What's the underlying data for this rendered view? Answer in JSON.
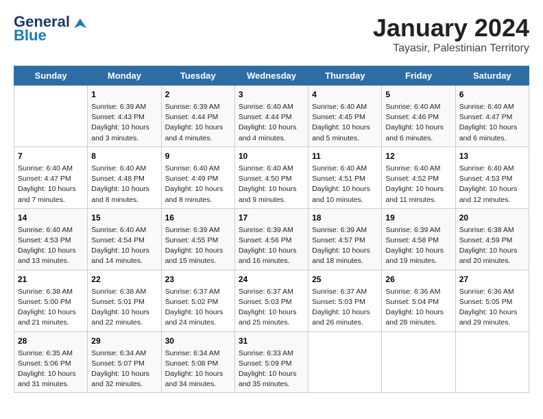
{
  "logo": {
    "line1": "General",
    "line2": "Blue"
  },
  "title": "January 2024",
  "subtitle": "Tayasir, Palestinian Territory",
  "days_of_week": [
    "Sunday",
    "Monday",
    "Tuesday",
    "Wednesday",
    "Thursday",
    "Friday",
    "Saturday"
  ],
  "weeks": [
    [
      {
        "day": "",
        "info": ""
      },
      {
        "day": "1",
        "info": "Sunrise: 6:39 AM\nSunset: 4:43 PM\nDaylight: 10 hours and 3 minutes."
      },
      {
        "day": "2",
        "info": "Sunrise: 6:39 AM\nSunset: 4:44 PM\nDaylight: 10 hours and 4 minutes."
      },
      {
        "day": "3",
        "info": "Sunrise: 6:40 AM\nSunset: 4:44 PM\nDaylight: 10 hours and 4 minutes."
      },
      {
        "day": "4",
        "info": "Sunrise: 6:40 AM\nSunset: 4:45 PM\nDaylight: 10 hours and 5 minutes."
      },
      {
        "day": "5",
        "info": "Sunrise: 6:40 AM\nSunset: 4:46 PM\nDaylight: 10 hours and 6 minutes."
      },
      {
        "day": "6",
        "info": "Sunrise: 6:40 AM\nSunset: 4:47 PM\nDaylight: 10 hours and 6 minutes."
      }
    ],
    [
      {
        "day": "7",
        "info": "Sunrise: 6:40 AM\nSunset: 4:47 PM\nDaylight: 10 hours and 7 minutes."
      },
      {
        "day": "8",
        "info": "Sunrise: 6:40 AM\nSunset: 4:48 PM\nDaylight: 10 hours and 8 minutes."
      },
      {
        "day": "9",
        "info": "Sunrise: 6:40 AM\nSunset: 4:49 PM\nDaylight: 10 hours and 8 minutes."
      },
      {
        "day": "10",
        "info": "Sunrise: 6:40 AM\nSunset: 4:50 PM\nDaylight: 10 hours and 9 minutes."
      },
      {
        "day": "11",
        "info": "Sunrise: 6:40 AM\nSunset: 4:51 PM\nDaylight: 10 hours and 10 minutes."
      },
      {
        "day": "12",
        "info": "Sunrise: 6:40 AM\nSunset: 4:52 PM\nDaylight: 10 hours and 11 minutes."
      },
      {
        "day": "13",
        "info": "Sunrise: 6:40 AM\nSunset: 4:53 PM\nDaylight: 10 hours and 12 minutes."
      }
    ],
    [
      {
        "day": "14",
        "info": "Sunrise: 6:40 AM\nSunset: 4:53 PM\nDaylight: 10 hours and 13 minutes."
      },
      {
        "day": "15",
        "info": "Sunrise: 6:40 AM\nSunset: 4:54 PM\nDaylight: 10 hours and 14 minutes."
      },
      {
        "day": "16",
        "info": "Sunrise: 6:39 AM\nSunset: 4:55 PM\nDaylight: 10 hours and 15 minutes."
      },
      {
        "day": "17",
        "info": "Sunrise: 6:39 AM\nSunset: 4:56 PM\nDaylight: 10 hours and 16 minutes."
      },
      {
        "day": "18",
        "info": "Sunrise: 6:39 AM\nSunset: 4:57 PM\nDaylight: 10 hours and 18 minutes."
      },
      {
        "day": "19",
        "info": "Sunrise: 6:39 AM\nSunset: 4:58 PM\nDaylight: 10 hours and 19 minutes."
      },
      {
        "day": "20",
        "info": "Sunrise: 6:38 AM\nSunset: 4:59 PM\nDaylight: 10 hours and 20 minutes."
      }
    ],
    [
      {
        "day": "21",
        "info": "Sunrise: 6:38 AM\nSunset: 5:00 PM\nDaylight: 10 hours and 21 minutes."
      },
      {
        "day": "22",
        "info": "Sunrise: 6:38 AM\nSunset: 5:01 PM\nDaylight: 10 hours and 22 minutes."
      },
      {
        "day": "23",
        "info": "Sunrise: 6:37 AM\nSunset: 5:02 PM\nDaylight: 10 hours and 24 minutes."
      },
      {
        "day": "24",
        "info": "Sunrise: 6:37 AM\nSunset: 5:03 PM\nDaylight: 10 hours and 25 minutes."
      },
      {
        "day": "25",
        "info": "Sunrise: 6:37 AM\nSunset: 5:03 PM\nDaylight: 10 hours and 26 minutes."
      },
      {
        "day": "26",
        "info": "Sunrise: 6:36 AM\nSunset: 5:04 PM\nDaylight: 10 hours and 28 minutes."
      },
      {
        "day": "27",
        "info": "Sunrise: 6:36 AM\nSunset: 5:05 PM\nDaylight: 10 hours and 29 minutes."
      }
    ],
    [
      {
        "day": "28",
        "info": "Sunrise: 6:35 AM\nSunset: 5:06 PM\nDaylight: 10 hours and 31 minutes."
      },
      {
        "day": "29",
        "info": "Sunrise: 6:34 AM\nSunset: 5:07 PM\nDaylight: 10 hours and 32 minutes."
      },
      {
        "day": "30",
        "info": "Sunrise: 6:34 AM\nSunset: 5:08 PM\nDaylight: 10 hours and 34 minutes."
      },
      {
        "day": "31",
        "info": "Sunrise: 6:33 AM\nSunset: 5:09 PM\nDaylight: 10 hours and 35 minutes."
      },
      {
        "day": "",
        "info": ""
      },
      {
        "day": "",
        "info": ""
      },
      {
        "day": "",
        "info": ""
      }
    ]
  ]
}
